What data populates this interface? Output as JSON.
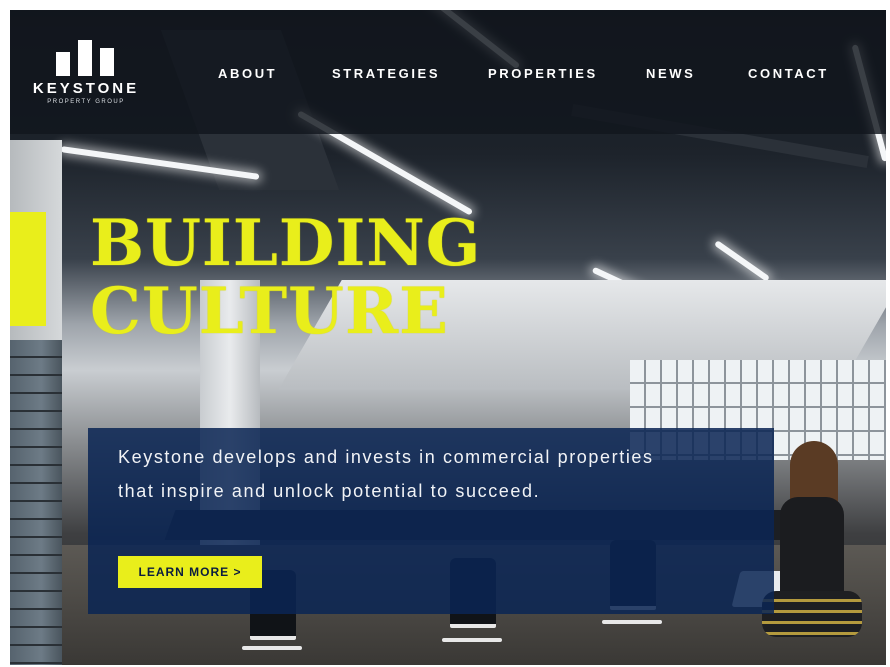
{
  "brand": {
    "name": "KEYSTONE",
    "tagline": "PROPERTY GROUP"
  },
  "nav": {
    "items": [
      {
        "label": "ABOUT"
      },
      {
        "label": "STRATEGIES"
      },
      {
        "label": "PROPERTIES"
      },
      {
        "label": "NEWS"
      },
      {
        "label": "CONTACT"
      }
    ]
  },
  "hero": {
    "title_line1": "BUILDING",
    "title_line2": "CULTURE",
    "description": "Keystone develops and invests in commercial properties that inspire and unlock potential to succeed.",
    "cta_label": "LEARN MORE >"
  },
  "colors": {
    "accent_yellow": "#e9ee1b",
    "navy_overlay": "#0a2554",
    "nav_background": "#11161d"
  }
}
